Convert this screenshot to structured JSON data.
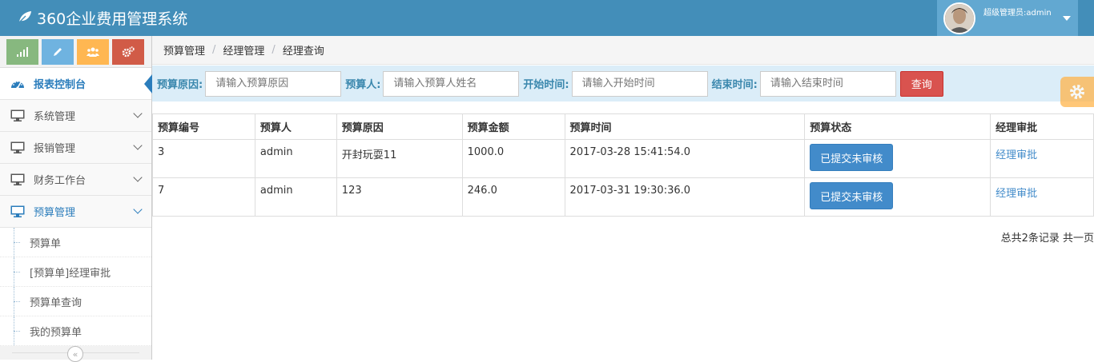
{
  "app": {
    "title": "360企业费用管理系统"
  },
  "user": {
    "label": "超级管理员:admin"
  },
  "shortcuts": [
    {
      "icon": "signal-icon"
    },
    {
      "icon": "pencil-icon"
    },
    {
      "icon": "users-icon"
    },
    {
      "icon": "cogs-icon"
    }
  ],
  "sidebar": {
    "items": [
      {
        "label": "报表控制台"
      },
      {
        "label": "系统管理"
      },
      {
        "label": "报销管理"
      },
      {
        "label": "财务工作台"
      },
      {
        "label": "预算管理"
      }
    ],
    "submenu": [
      {
        "label": "预算单"
      },
      {
        "label": "[预算单]经理审批"
      },
      {
        "label": "预算单查询"
      },
      {
        "label": "我的预算单"
      }
    ],
    "collapse_symbol": "«"
  },
  "breadcrumb": [
    "预算管理",
    "经理管理",
    "经理查询"
  ],
  "search": {
    "reason_label": "预算原因:",
    "reason_placeholder": "请输入预算原因",
    "person_label": "预算人:",
    "person_placeholder": "请输入预算人姓名",
    "start_label": "开始时间:",
    "start_placeholder": "请输入开始时间",
    "end_label": "结束时间:",
    "end_placeholder": "请输入结束时间",
    "query_button": "查询"
  },
  "table": {
    "headers": [
      "预算编号",
      "预算人",
      "预算原因",
      "预算金额",
      "预算时间",
      "预算状态",
      "经理审批"
    ],
    "rows": [
      {
        "id": "3",
        "person": "admin",
        "reason": "开封玩耍11",
        "amount": "1000.0",
        "time": "2017-03-28 15:41:54.0",
        "status": "已提交未审核",
        "action": "经理审批"
      },
      {
        "id": "7",
        "person": "admin",
        "reason": "123",
        "amount": "246.0",
        "time": "2017-03-31 19:30:36.0",
        "status": "已提交未审核",
        "action": "经理审批"
      }
    ]
  },
  "pager": {
    "text": "总共2条记录 共一页"
  },
  "colors": {
    "navbar": "#438eb9",
    "accent": "#2b7dbc",
    "danger": "#d9534f",
    "primary": "#428bca"
  }
}
